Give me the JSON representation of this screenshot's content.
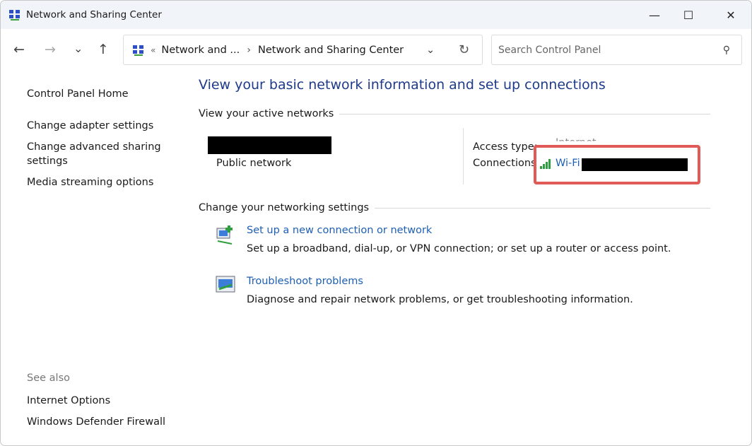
{
  "window": {
    "title": "Network and Sharing Center",
    "minimize": "—",
    "maximize": "☐",
    "close": "✕"
  },
  "nav": {
    "back": "←",
    "forward": "→",
    "recent": "⌄",
    "up": "↑"
  },
  "address": {
    "separator": "«",
    "crumbs": [
      "Network and ...",
      "Network and Sharing Center"
    ],
    "chev": "›",
    "dropdown": "⌄",
    "refresh": "↻"
  },
  "search": {
    "placeholder": "Search Control Panel",
    "icon": "⚲"
  },
  "sidebar": {
    "items": [
      "Control Panel Home",
      "Change adapter settings",
      "Change advanced sharing settings",
      "Media streaming options"
    ],
    "see_also": "See also",
    "see_also_items": [
      "Internet Options",
      "Windows Defender Firewall"
    ]
  },
  "main": {
    "title": "View your basic network information and set up connections",
    "active_networks": "View your active networks",
    "network_type": "Public network",
    "access_type_label": "Access type:",
    "access_type_value": "Internet",
    "connections_label": "Connections",
    "connection_name": "Wi-Fi",
    "change_settings": "Change your networking settings",
    "tasks": [
      {
        "link": "Set up a new connection or network",
        "desc": "Set up a broadband, dial-up, or VPN connection; or set up a router or access point."
      },
      {
        "link": "Troubleshoot problems",
        "desc": "Diagnose and repair network problems, or get troubleshooting information."
      }
    ]
  },
  "colors": {
    "title_blue": "#1e3a8a",
    "link_blue": "#1e5fb4",
    "highlight_red": "#e05a57",
    "signal_green": "#2e9e3e"
  }
}
